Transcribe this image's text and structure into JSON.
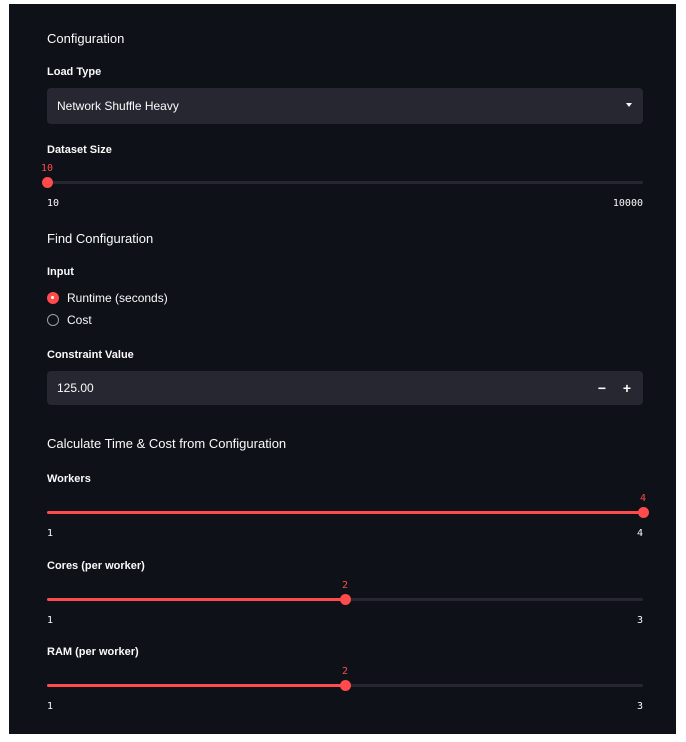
{
  "configuration": {
    "title": "Configuration",
    "load_type": {
      "label": "Load Type",
      "selected": "Network Shuffle Heavy",
      "icon": "chevron-down-icon"
    },
    "dataset_size": {
      "label": "Dataset Size",
      "value": "10",
      "min": "10",
      "max": "10000",
      "value_num": 10,
      "min_num": 10,
      "max_num": 10000
    }
  },
  "find_configuration": {
    "title": "Find Configuration",
    "input_label": "Input",
    "options": [
      {
        "label": "Runtime (seconds)",
        "selected": true
      },
      {
        "label": "Cost",
        "selected": false
      }
    ],
    "constraint": {
      "label": "Constraint Value",
      "value": "125.00",
      "decrement": "−",
      "increment": "+"
    }
  },
  "calculate": {
    "title": "Calculate Time & Cost from Configuration",
    "workers": {
      "label": "Workers",
      "value": "4",
      "min": "1",
      "max": "4",
      "value_num": 4,
      "min_num": 1,
      "max_num": 4
    },
    "cores": {
      "label": "Cores (per worker)",
      "value": "2",
      "min": "1",
      "max": "3",
      "value_num": 2,
      "min_num": 1,
      "max_num": 3
    },
    "ram": {
      "label": "RAM (per worker)",
      "value": "2",
      "min": "1",
      "max": "3",
      "value_num": 2,
      "min_num": 1,
      "max_num": 3
    }
  },
  "colors": {
    "background": "#0e1117",
    "widget": "#262730",
    "accent": "#ff4b4b",
    "text": "#fafafa"
  }
}
